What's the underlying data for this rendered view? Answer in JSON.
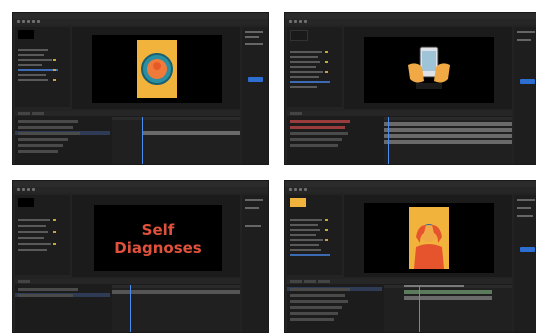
{
  "screens": [
    {
      "name": "screen-1",
      "canvas_content": "badge-illustration"
    },
    {
      "name": "screen-2",
      "canvas_content": "hands-with-phone"
    },
    {
      "name": "screen-3",
      "canvas_content": "title-text",
      "title_text": "Self Diagnoses"
    },
    {
      "name": "screen-4",
      "canvas_content": "person-holding-head"
    }
  ],
  "colors": {
    "app_background": "#232323",
    "canvas": "#000000",
    "accent": "#2d6fd0",
    "title_text": "#e0513b",
    "badge_yellow": "#f2b33d",
    "badge_teal": "#2a8fa3",
    "figure_orange": "#e5542c",
    "hand_skin": "#f0a945"
  },
  "icons": [
    "badge-icon",
    "phone-icon",
    "person-icon"
  ]
}
